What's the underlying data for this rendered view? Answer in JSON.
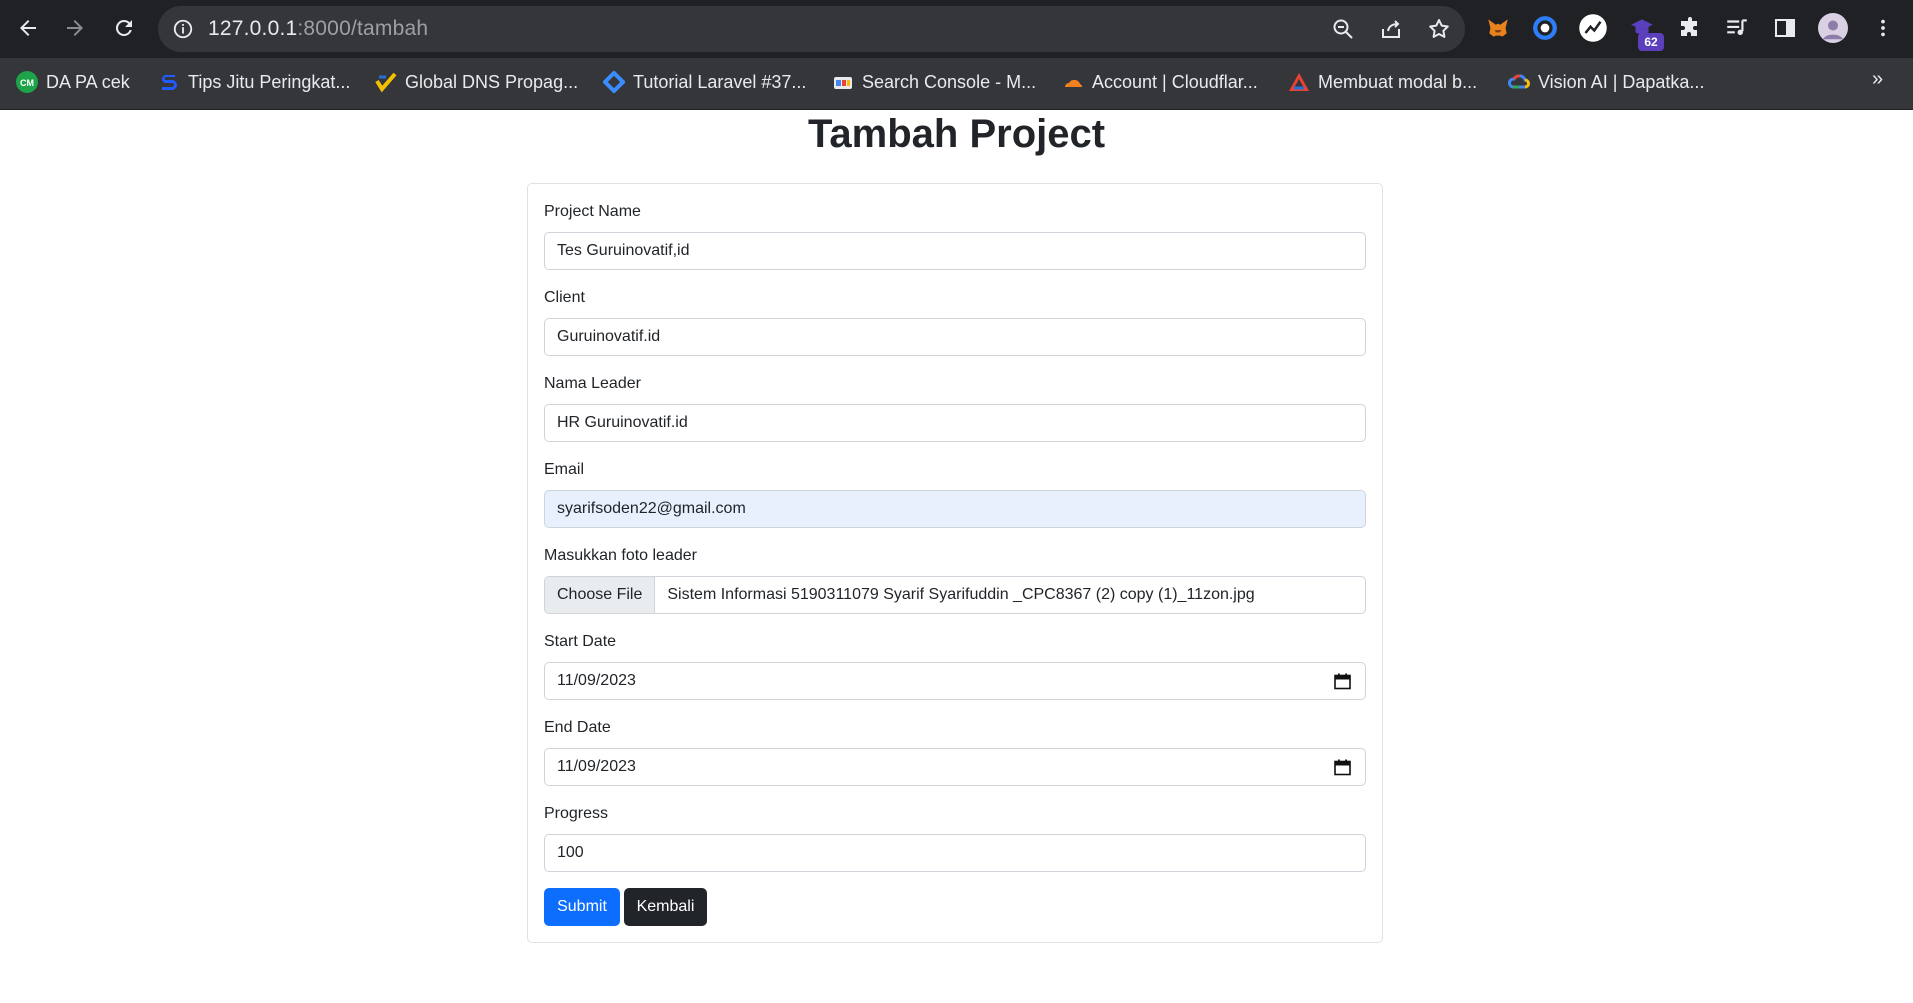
{
  "browser": {
    "url_host": "127.0.0.1",
    "url_rest": ":8000/tambah",
    "extension_badge": "62",
    "bookmarks": [
      {
        "label": "DA PA cek",
        "icon": "cm-green-circle-icon"
      },
      {
        "label": "Tips Jitu Peringkat...",
        "icon": "blue-s-icon"
      },
      {
        "label": "Global DNS Propag...",
        "icon": "dns-check-icon"
      },
      {
        "label": "Tutorial Laravel #37...",
        "icon": "blue-diamond-icon"
      },
      {
        "label": "Search Console - M...",
        "icon": "search-console-icon"
      },
      {
        "label": "Account | Cloudflar...",
        "icon": "cloudflare-icon"
      },
      {
        "label": "Membuat modal b...",
        "icon": "triangle-logo-icon"
      },
      {
        "label": "Vision AI | Dapatka...",
        "icon": "google-cloud-icon"
      }
    ],
    "more_bookmarks": "»"
  },
  "page": {
    "title": "Tambah Project",
    "fields": [
      {
        "label": "Project Name",
        "value": "Tes Guruinovatif,id"
      },
      {
        "label": "Client",
        "value": "Guruinovatif.id"
      },
      {
        "label": "Nama Leader",
        "value": "HR Guruinovatif.id"
      },
      {
        "label": "Email",
        "value": "syarifsoden22@gmail.com"
      },
      {
        "label": "Masukkan foto leader",
        "button": "Choose File",
        "value": "Sistem Informasi 5190311079 Syarif Syarifuddin _CPC8367 (2) copy (1)_11zon.jpg"
      },
      {
        "label": "Start Date",
        "value": "11/09/2023"
      },
      {
        "label": "End Date",
        "value": "11/09/2023"
      },
      {
        "label": "Progress",
        "value": "100"
      }
    ],
    "submit_label": "Submit",
    "back_label": "Kembali"
  },
  "colors": {
    "primary": "#0d6efd",
    "dark": "#212529",
    "autofill": "#e8f0fe"
  }
}
